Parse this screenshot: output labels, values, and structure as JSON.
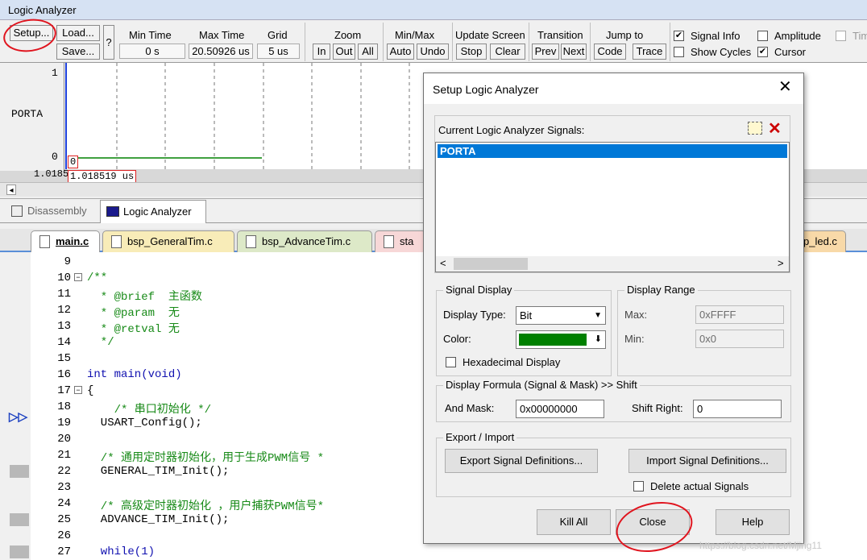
{
  "window": {
    "title": "Logic Analyzer"
  },
  "toolbar": {
    "setup": "Setup...",
    "load": "Load...",
    "save": "Save...",
    "help": "?",
    "min_time_label": "Min Time",
    "min_time_value": "0 s",
    "max_time_label": "Max Time",
    "max_time_value": "20.50926 us",
    "grid_label": "Grid",
    "grid_value": "5 us",
    "zoom_label": "Zoom",
    "zoom_in": "In",
    "zoom_out": "Out",
    "zoom_all": "All",
    "minmax_label": "Min/Max",
    "auto": "Auto",
    "undo": "Undo",
    "update_label": "Update Screen",
    "stop": "Stop",
    "clear": "Clear",
    "transition_label": "Transition",
    "prev": "Prev",
    "next": "Next",
    "jumpto_label": "Jump to",
    "code": "Code",
    "trace": "Trace",
    "signal_info": "Signal Info",
    "amplitude": "Amplitude",
    "timestamps": "Tim",
    "show_cycles": "Show Cycles",
    "cursor": "Cursor"
  },
  "waveform": {
    "signal_name": "PORTA",
    "y_high": "1",
    "y_low": "0",
    "cursor_value": "0",
    "time_left": "1.0185",
    "time_cursor": "1.018519 us",
    "trace_color": "#008000"
  },
  "view_tabs": {
    "disassembly": "Disassembly",
    "logic_analyzer": "Logic Analyzer"
  },
  "file_tabs": [
    "main.c",
    "bsp_GeneralTim.c",
    "bsp_AdvanceTim.c",
    "sta",
    "p_led.c"
  ],
  "code_lines": [
    {
      "n": "9",
      "text": ""
    },
    {
      "n": "10",
      "text": "/**"
    },
    {
      "n": "11",
      "text": "  * @brief  主函数"
    },
    {
      "n": "12",
      "text": "  * @param  无"
    },
    {
      "n": "13",
      "text": "  * @retval 无"
    },
    {
      "n": "14",
      "text": "  */"
    },
    {
      "n": "15",
      "text": ""
    },
    {
      "n": "16",
      "text": "int main(void)"
    },
    {
      "n": "17",
      "text": "{"
    },
    {
      "n": "18",
      "text": "    /* 串口初始化 */"
    },
    {
      "n": "19",
      "text": "  USART_Config();"
    },
    {
      "n": "20",
      "text": ""
    },
    {
      "n": "21",
      "text": "  /* 通用定时器初始化，用于生成PWM信号 *"
    },
    {
      "n": "22",
      "text": "  GENERAL_TIM_Init();"
    },
    {
      "n": "23",
      "text": ""
    },
    {
      "n": "24",
      "text": "  /* 高级定时器初始化 ，用户捕获PWM信号*"
    },
    {
      "n": "25",
      "text": "  ADVANCE_TIM_Init();"
    },
    {
      "n": "26",
      "text": ""
    },
    {
      "n": "27",
      "text": "  while(1)"
    }
  ],
  "dialog": {
    "title": "Setup Logic Analyzer",
    "signals_label": "Current Logic Analyzer Signals:",
    "signals": [
      "PORTA"
    ],
    "signal_display_group": "Signal Display",
    "display_type_label": "Display Type:",
    "display_type_value": "Bit",
    "color_label": "Color:",
    "color_value": "#008000",
    "hex_display": "Hexadecimal Display",
    "display_range_group": "Display Range",
    "max_label": "Max:",
    "max_value": "0xFFFF",
    "min_label": "Min:",
    "min_value": "0x0",
    "formula_group": "Display Formula (Signal & Mask) >> Shift",
    "and_mask_label": "And Mask:",
    "and_mask_value": "0x00000000",
    "shift_right_label": "Shift Right:",
    "shift_right_value": "0",
    "export_group": "Export / Import",
    "export_button": "Export Signal Definitions...",
    "import_button": "Import Signal Definitions...",
    "delete_signals": "Delete actual Signals",
    "kill_all": "Kill All",
    "close": "Close",
    "help": "Help"
  },
  "watermark": "https://blog.csdn.net/Mjing11"
}
